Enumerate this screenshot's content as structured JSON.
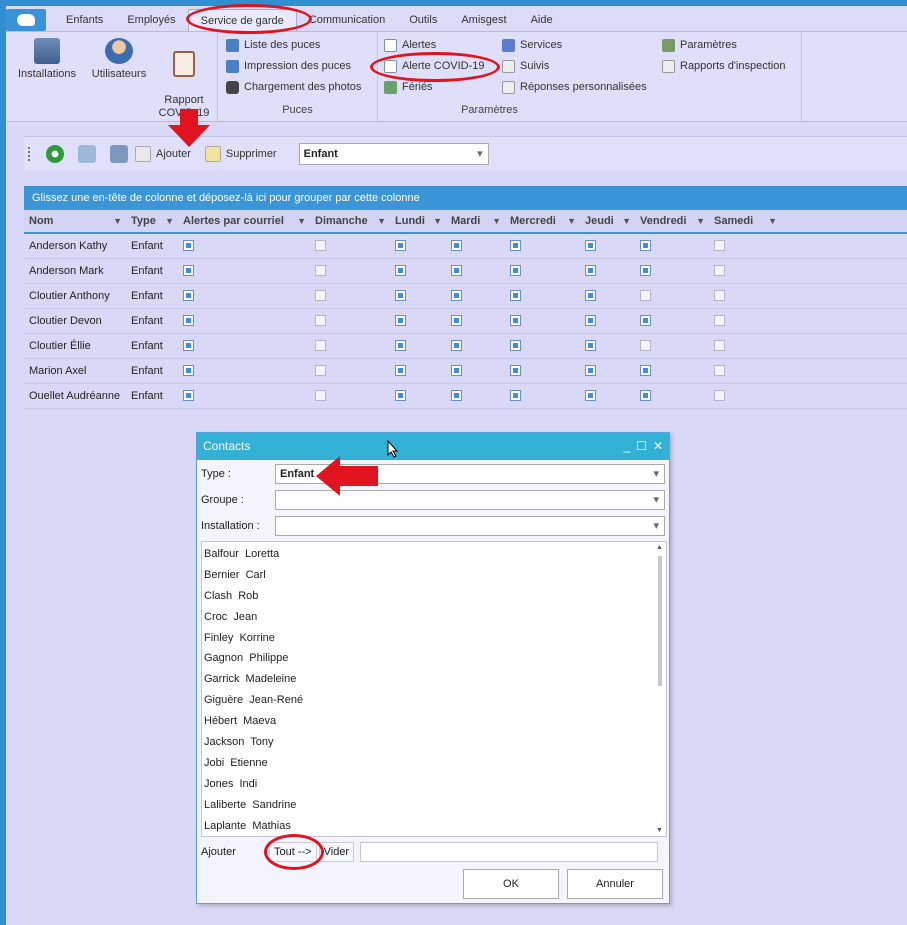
{
  "menu": {
    "items": [
      "Enfants",
      "Employés",
      "Service de garde",
      "Communication",
      "Outils",
      "Amisgest",
      "Aide"
    ],
    "active": "Service de garde"
  },
  "ribbon": {
    "big_buttons": [
      {
        "label": "Installations",
        "icon": "buildings-icon"
      },
      {
        "label": "Utilisateurs",
        "icon": "users-icon"
      },
      {
        "label": "Rapport\nCOVID-19",
        "icon": "clipboard-icon"
      }
    ],
    "puces": {
      "items": [
        "Liste des puces",
        "Impression des puces",
        "Chargement des photos"
      ],
      "group_label": "Puces"
    },
    "parametres": {
      "col1": [
        "Alertes",
        "Alerte COVID-19",
        "Fériés"
      ],
      "col2": [
        "Services",
        "Suivis",
        "Réponses personnalisées"
      ],
      "group_label": "Paramètres"
    },
    "extra": [
      "Paramètres",
      "Rapports d'inspection"
    ]
  },
  "toolbar": {
    "add_label": "Ajouter",
    "delete_label": "Supprimer",
    "type_value": "Enfant"
  },
  "grid": {
    "group_hint": "Glissez une en-tête de colonne et déposez-là ici pour grouper par cette colonne",
    "columns": [
      "Nom",
      "Type",
      "Alertes par courriel",
      "Dimanche",
      "Lundi",
      "Mardi",
      "Mercredi",
      "Jeudi",
      "Vendredi",
      "Samedi"
    ],
    "rows": [
      {
        "nom": "Anderson Kathy",
        "type": "Enfant",
        "checks": [
          true,
          false,
          true,
          true,
          true,
          true,
          true,
          false
        ]
      },
      {
        "nom": "Anderson Mark",
        "type": "Enfant",
        "checks": [
          true,
          false,
          true,
          true,
          true,
          true,
          true,
          false
        ]
      },
      {
        "nom": "Cloutier Anthony",
        "type": "Enfant",
        "checks": [
          true,
          false,
          true,
          true,
          true,
          true,
          false,
          false
        ]
      },
      {
        "nom": "Cloutier Devon",
        "type": "Enfant",
        "checks": [
          true,
          false,
          true,
          true,
          true,
          true,
          true,
          false
        ]
      },
      {
        "nom": "Cloutier Éllie",
        "type": "Enfant",
        "checks": [
          true,
          false,
          true,
          true,
          true,
          true,
          false,
          false
        ]
      },
      {
        "nom": "Marion Axel",
        "type": "Enfant",
        "checks": [
          true,
          false,
          true,
          true,
          true,
          true,
          true,
          false
        ]
      },
      {
        "nom": "Ouellet Audréanne",
        "type": "Enfant",
        "checks": [
          true,
          false,
          true,
          true,
          true,
          true,
          true,
          false
        ]
      }
    ]
  },
  "dialog": {
    "title": "Contacts",
    "type_label": "Type :",
    "type_value": "Enfant",
    "groupe_label": "Groupe :",
    "installation_label": "Installation :",
    "contacts": [
      "Balfour  Loretta",
      "Bernier  Carl",
      "Clash  Rob",
      "Croc  Jean",
      "Finley  Korrine",
      "Gagnon  Philippe",
      "Garrick  Madeleine",
      "Giguère  Jean-René",
      "Hébert  Maeva",
      "Jackson  Tony",
      "Jobi  Etienne",
      "Jones  Indi",
      "Laliberte  Sandrine",
      "Laplante  Mathias"
    ],
    "add_label": "Ajouter",
    "all_label": "Tout -->",
    "clear_label": "Vider",
    "ok_label": "OK",
    "cancel_label": "Annuler"
  },
  "colors": {
    "accent": "#3b95d7",
    "annotation": "#e0141e"
  }
}
